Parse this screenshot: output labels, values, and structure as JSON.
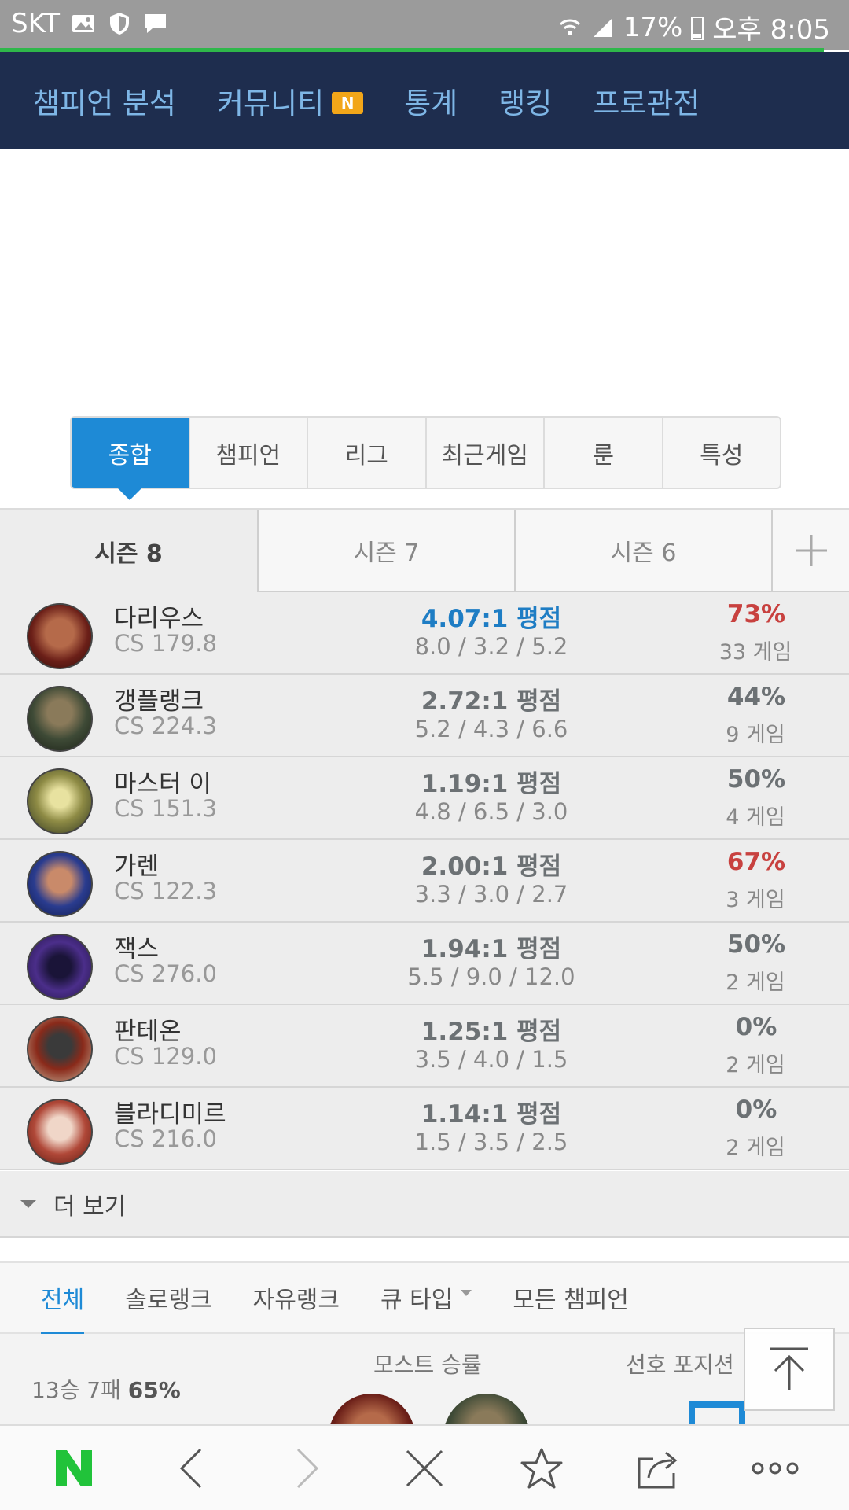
{
  "status_bar": {
    "carrier": "SKT",
    "battery": "17%",
    "time": "오후 8:05"
  },
  "nav": {
    "items": [
      {
        "label": "챔피언 분석"
      },
      {
        "label": "커뮤니티",
        "badge": "N"
      },
      {
        "label": "통계"
      },
      {
        "label": "랭킹"
      },
      {
        "label": "프로관전"
      }
    ]
  },
  "tabs": [
    "종합",
    "챔피언",
    "리그",
    "최근게임",
    "룬",
    "특성"
  ],
  "seasons": [
    "시즌 8",
    "시즌 7",
    "시즌 6"
  ],
  "champions": [
    {
      "name": "다리우스",
      "cs": "CS 179.8",
      "kda": "4.07:1 평점",
      "kda_detail": "8.0 / 3.2 / 5.2",
      "winrate": "73%",
      "games": "33 게임"
    },
    {
      "name": "갱플랭크",
      "cs": "CS 224.3",
      "kda": "2.72:1 평점",
      "kda_detail": "5.2 / 4.3 / 6.6",
      "winrate": "44%",
      "games": "9 게임"
    },
    {
      "name": "마스터 이",
      "cs": "CS 151.3",
      "kda": "1.19:1 평점",
      "kda_detail": "4.8 / 6.5 / 3.0",
      "winrate": "50%",
      "games": "4 게임"
    },
    {
      "name": "가렌",
      "cs": "CS 122.3",
      "kda": "2.00:1 평점",
      "kda_detail": "3.3 / 3.0 / 2.7",
      "winrate": "67%",
      "games": "3 게임"
    },
    {
      "name": "잭스",
      "cs": "CS 276.0",
      "kda": "1.94:1 평점",
      "kda_detail": "5.5 / 9.0 / 12.0",
      "winrate": "50%",
      "games": "2 게임"
    },
    {
      "name": "판테온",
      "cs": "CS 129.0",
      "kda": "1.25:1 평점",
      "kda_detail": "3.5 / 4.0 / 1.5",
      "winrate": "0%",
      "games": "2 게임"
    },
    {
      "name": "블라디미르",
      "cs": "CS 216.0",
      "kda": "1.14:1 평점",
      "kda_detail": "1.5 / 3.5 / 2.5",
      "winrate": "0%",
      "games": "2 게임"
    }
  ],
  "more_label": "더 보기",
  "queue_tabs": [
    "전체",
    "솔로랭크",
    "자유랭크",
    "큐 타입",
    "모든 챔피언"
  ],
  "summary": {
    "record": "13승 7패",
    "record_rate": "65%",
    "most_winrate_label": "모스트 승률",
    "preferred_position_label": "선호 포지션"
  },
  "colors": {
    "nav_bg": "#1e2d4e",
    "accent": "#1e8ad6",
    "red": "#c8413f",
    "naver_green": "#21c33a"
  }
}
